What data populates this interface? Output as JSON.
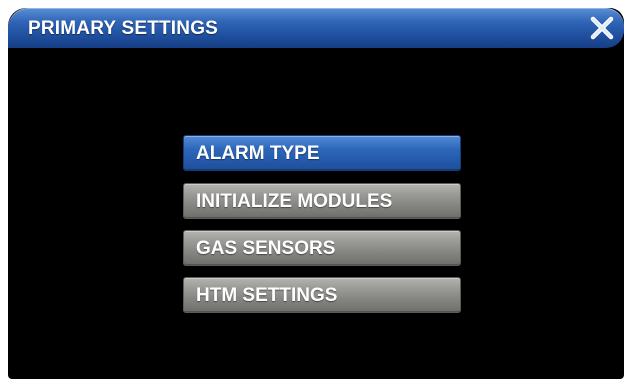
{
  "window": {
    "title": "PRIMARY SETTINGS",
    "close_icon": "close-x-icon"
  },
  "menu": {
    "items": [
      {
        "label": "ALARM TYPE",
        "selected": true
      },
      {
        "label": "INITIALIZE MODULES",
        "selected": false
      },
      {
        "label": "GAS SENSORS",
        "selected": false
      },
      {
        "label": "HTM SETTINGS",
        "selected": false
      }
    ]
  },
  "colors": {
    "accent": "#1f4f9e",
    "button_grey": "#8a8a86",
    "background": "#000000"
  }
}
